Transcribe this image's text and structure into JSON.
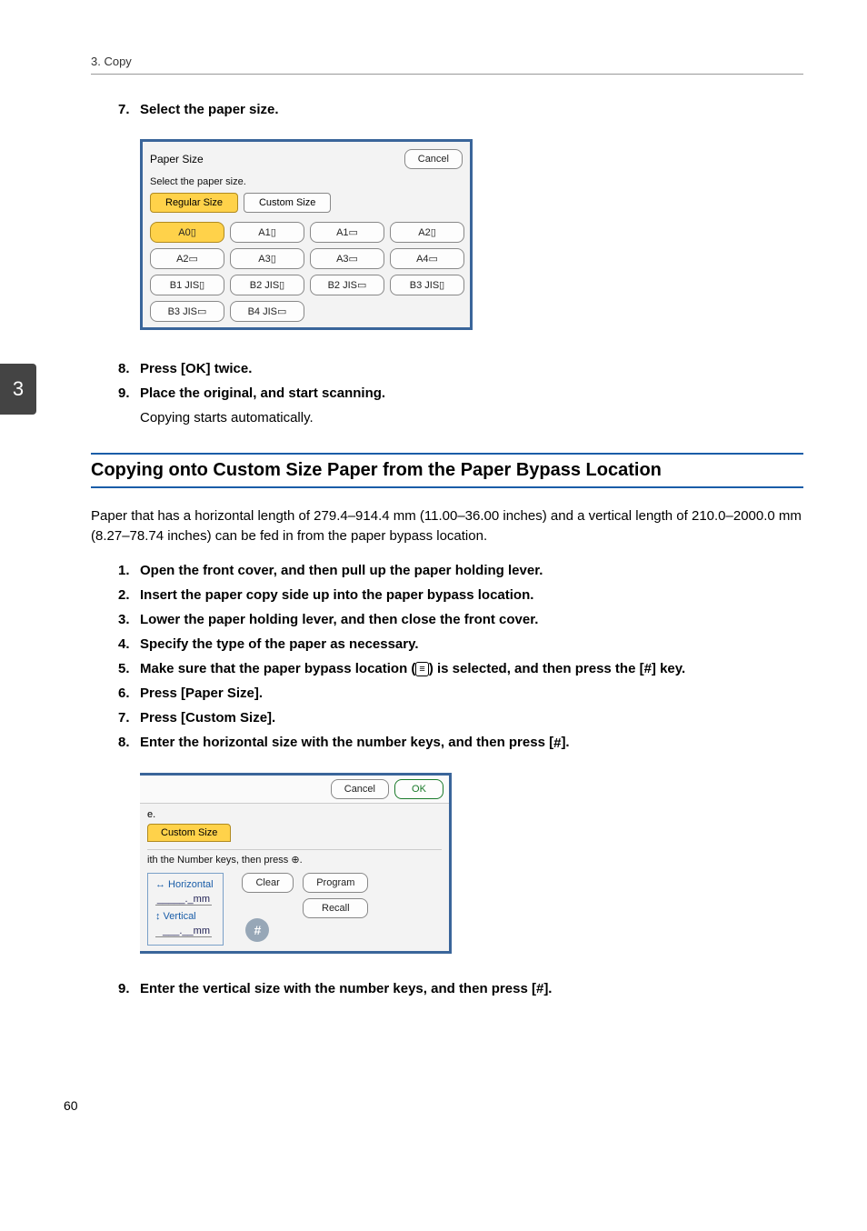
{
  "header": {
    "breadcrumb": "3. Copy"
  },
  "side_tab": {
    "label": "3"
  },
  "steps_top": {
    "7": {
      "num": "7.",
      "text": "Select the paper size."
    },
    "8": {
      "num": "8.",
      "text": "Press [OK] twice."
    },
    "9": {
      "num": "9.",
      "text": "Place the original, and start scanning."
    }
  },
  "note_after_9": "Copying starts automatically.",
  "illu1": {
    "title": "Paper Size",
    "cancel": "Cancel",
    "subtext": "Select the paper size.",
    "tabs": {
      "regular": "Regular Size",
      "custom": "Custom Size"
    },
    "grid": [
      "A0▯",
      "A1▯",
      "A1▭",
      "A2▯",
      "A2▭",
      "A3▯",
      "A3▭",
      "A4▭",
      "B1 JIS▯",
      "B2 JIS▯",
      "B2 JIS▭",
      "B3 JIS▯",
      "B3 JIS▭",
      "B4 JIS▭"
    ]
  },
  "section_heading": "Copying onto Custom Size Paper from the Paper Bypass Location",
  "paragraph": "Paper that has a horizontal length of 279.4–914.4 mm (11.00–36.00 inches) and a vertical length of 210.0–2000.0 mm (8.27–78.74 inches) can be fed in from the paper bypass location.",
  "steps_bottom": {
    "1": {
      "num": "1.",
      "text": "Open the front cover, and then pull up the paper holding lever."
    },
    "2": {
      "num": "2.",
      "text": "Insert the paper copy side up into the paper bypass location."
    },
    "3": {
      "num": "3.",
      "text": "Lower the paper holding lever, and then close the front cover."
    },
    "4": {
      "num": "4.",
      "text": "Specify the type of the paper as necessary."
    },
    "5": {
      "num": "5.",
      "pre": "Make sure that the paper bypass location (",
      "mid": ") is selected, and then press the [",
      "post": "] key."
    },
    "6": {
      "num": "6.",
      "text": "Press [Paper Size]."
    },
    "7": {
      "num": "7.",
      "text": "Press [Custom Size]."
    },
    "8": {
      "num": "8.",
      "pre": "Enter the horizontal size with the number keys, and then press [",
      "post": "]."
    },
    "9": {
      "num": "9.",
      "pre": "Enter the vertical size with the number keys, and then press [",
      "post": "]."
    }
  },
  "illu2": {
    "cancel": "Cancel",
    "ok": "OK",
    "e": "e.",
    "tab_custom": "Custom Size",
    "instr": "ith the Number keys, then press ⊕.",
    "horiz_label": "↔ Horizontal",
    "vert_label": "↕ Vertical",
    "horiz_value": "_____._mm",
    "vert_value": "___.__mm",
    "clear": "Clear",
    "hash": "#",
    "program": "Program",
    "recall": "Recall"
  },
  "icons": {
    "bypass": "≡",
    "hash": "#"
  },
  "page_number": "60"
}
